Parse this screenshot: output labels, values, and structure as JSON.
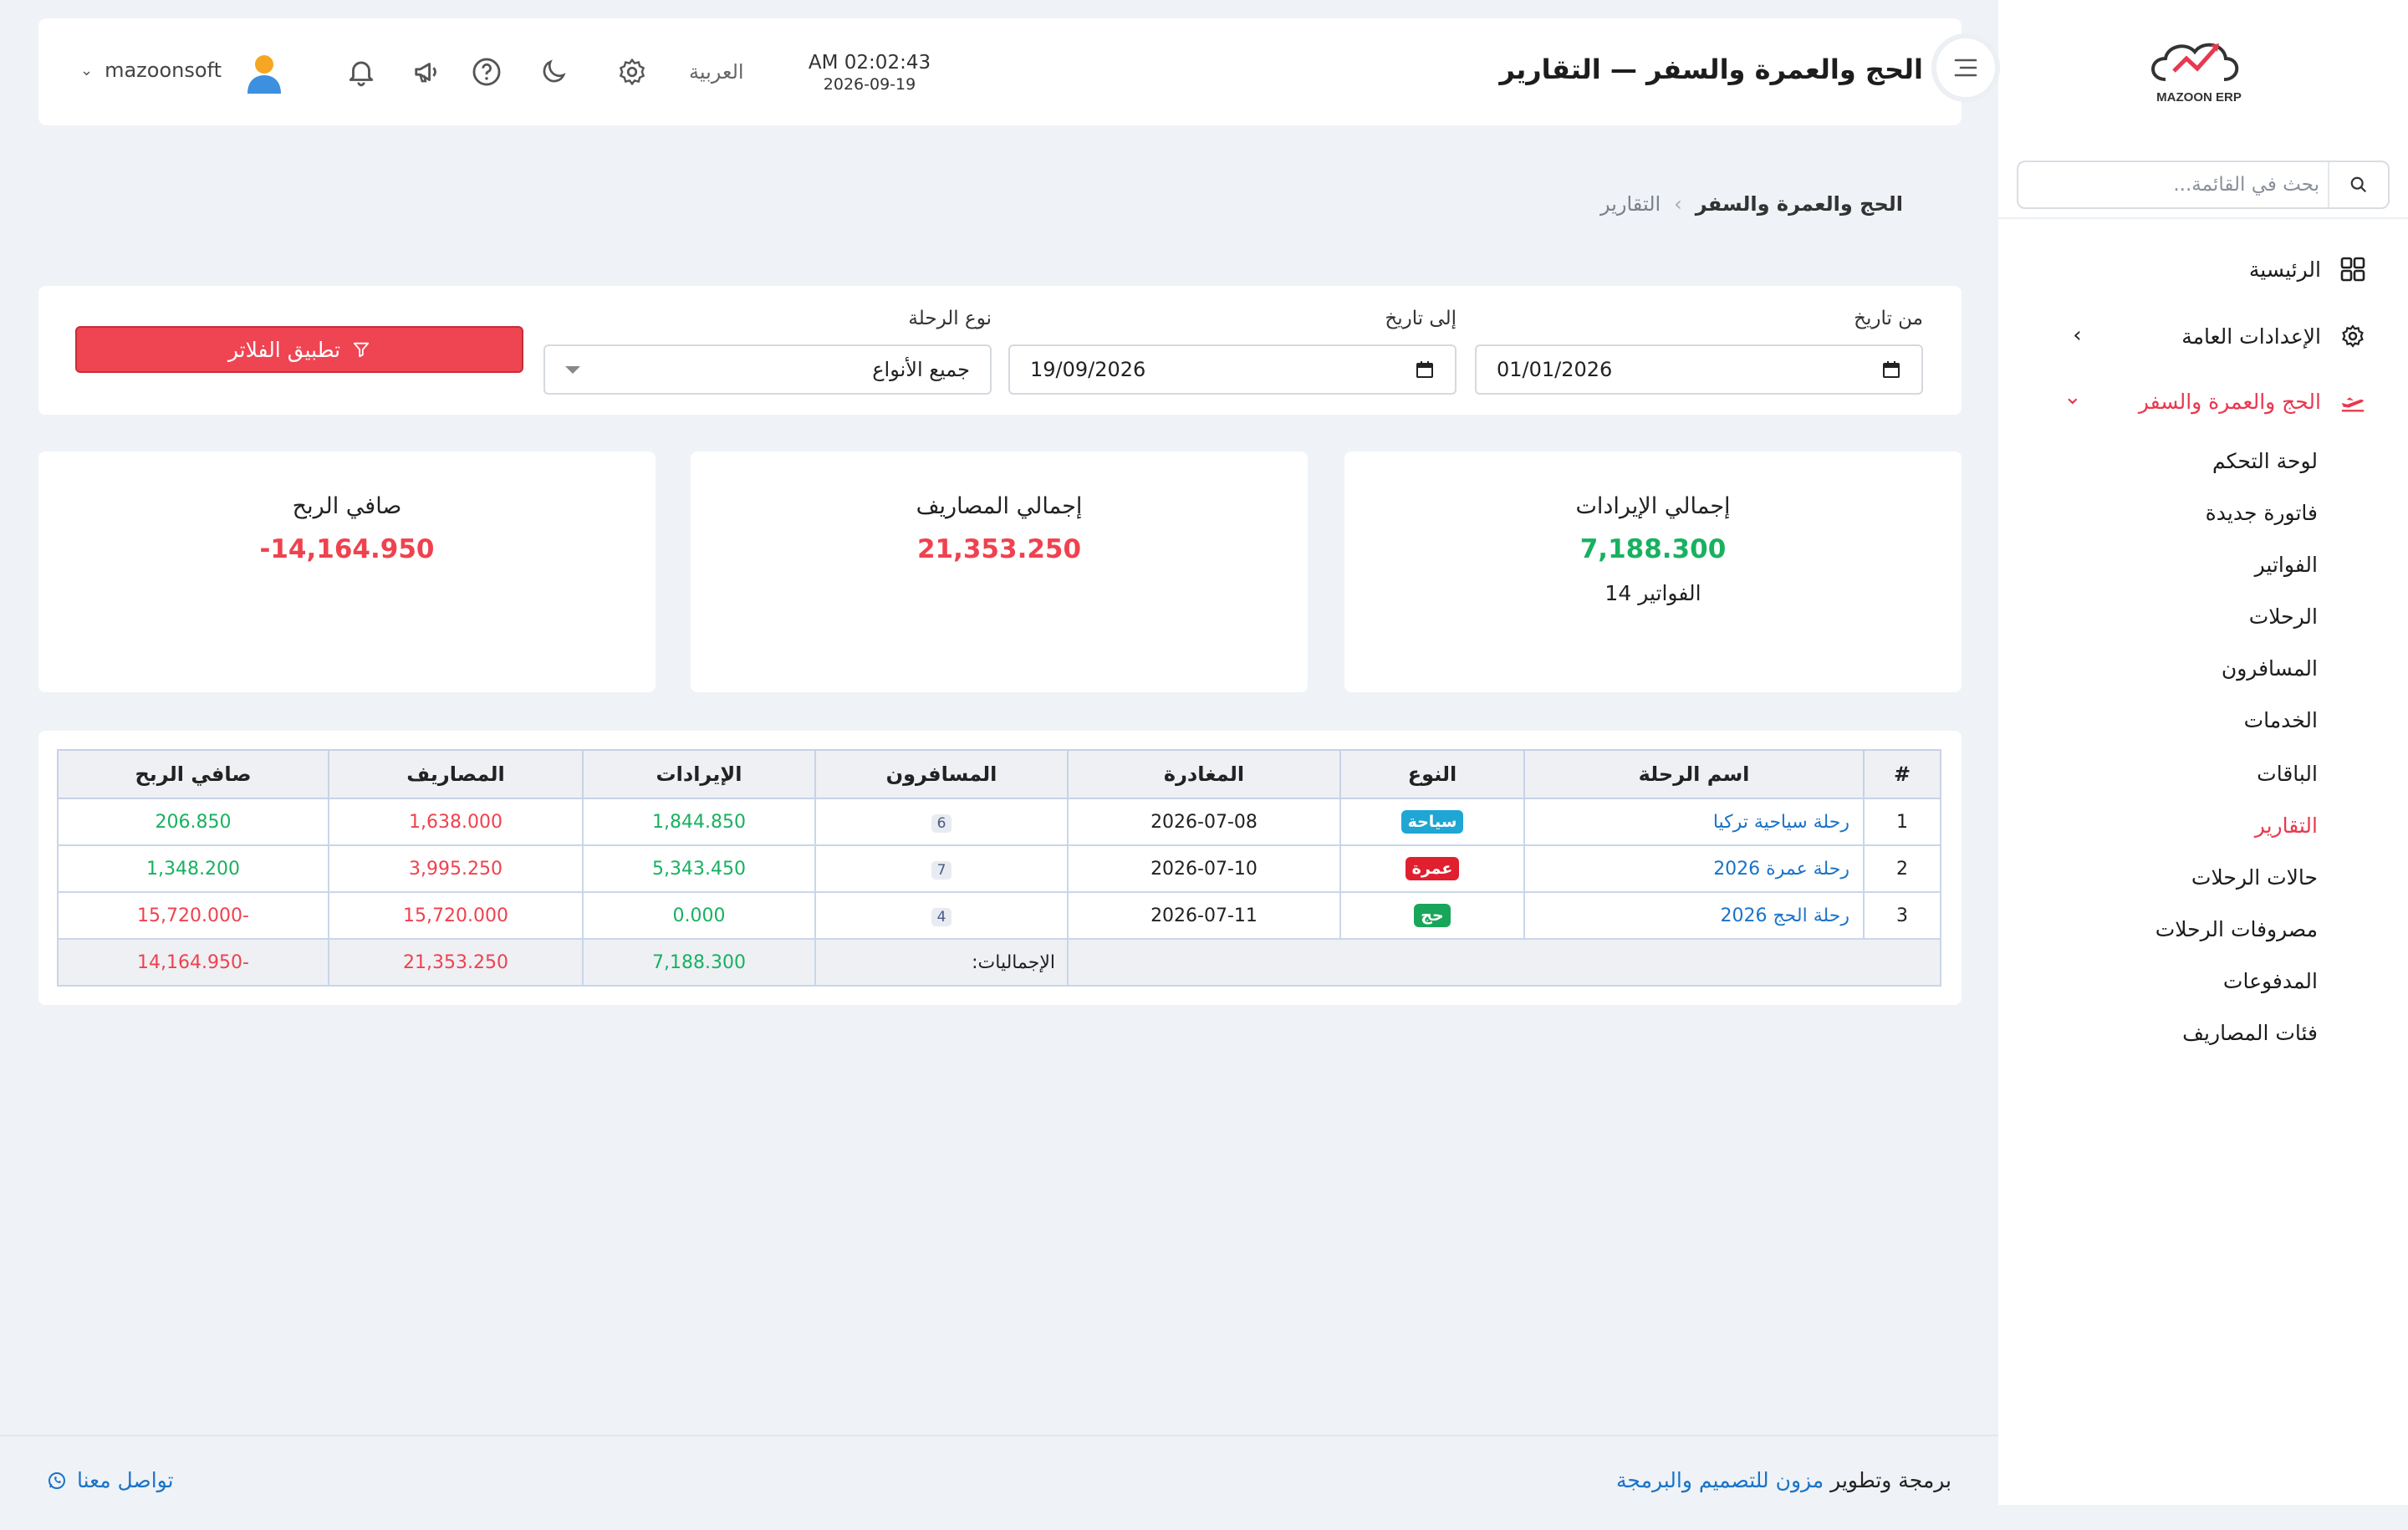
{
  "sidebar": {
    "logo_text": "MAZOON ERP",
    "search_placeholder": "بحث في القائمة...",
    "menu": [
      {
        "label": "الرئيسية"
      },
      {
        "label": "الإعدادات العامة"
      },
      {
        "label": "الحج والعمرة والسفر"
      }
    ],
    "submenu": [
      "لوحة التحكم",
      "فاتورة جديدة",
      "الفواتير",
      "الرحلات",
      "المسافرون",
      "الخدمات",
      "الباقات",
      "التقارير",
      "حالات الرحلات",
      "مصروفات الرحلات",
      "المدفوعات",
      "فئات المصاريف"
    ]
  },
  "header": {
    "title": "الحج والعمرة والسفر — التقارير",
    "time": "AM 02:02:43",
    "date": "2026-09-19",
    "language": "العربية",
    "username": "mazoonsoft"
  },
  "breadcrumb": {
    "parent": "الحج والعمرة والسفر",
    "current": "التقارير"
  },
  "filters": {
    "from_label": "من تاريخ",
    "from_value": "01/01/2026",
    "to_label": "إلى تاريخ",
    "to_value": "19/09/2026",
    "type_label": "نوع الرحلة",
    "type_value": "جميع الأنواع",
    "apply_label": "تطبيق الفلاتر"
  },
  "stats": {
    "revenue": {
      "label": "إجمالي الإيرادات",
      "value": "7,188.300",
      "sub": "14 الفواتير"
    },
    "expenses": {
      "label": "إجمالي المصاريف",
      "value": "21,353.250"
    },
    "profit": {
      "label": "صافي الربح",
      "value": "-14,164.950"
    }
  },
  "table": {
    "headers": [
      "#",
      "اسم الرحلة",
      "النوع",
      "المغادرة",
      "المسافرون",
      "الإيرادات",
      "المصاريف",
      "صافي الربح"
    ],
    "rows": [
      {
        "n": "1",
        "name": "رحلة سياحية تركيا",
        "type": "سياحة",
        "type_color": "#1fa6d4",
        "date": "2026-07-08",
        "pax": "6",
        "revenue": "1,844.850",
        "expenses": "1,638.000",
        "profit": "206.850",
        "profit_color": "#18b160"
      },
      {
        "n": "2",
        "name": "رحلة عمرة 2026",
        "type": "عمرة",
        "type_color": "#e0202f",
        "date": "2026-07-10",
        "pax": "7",
        "revenue": "5,343.450",
        "expenses": "3,995.250",
        "profit": "1,348.200",
        "profit_color": "#18b160"
      },
      {
        "n": "3",
        "name": "رحلة الحج 2026",
        "type": "حج",
        "type_color": "#1aa65a",
        "date": "2026-07-11",
        "pax": "4",
        "revenue": "0.000",
        "expenses": "15,720.000",
        "profit": "-15,720.000",
        "profit_color": "#f0414e"
      }
    ],
    "totals": {
      "label": "الإجماليات:",
      "revenue": "7,188.300",
      "expenses": "21,353.250",
      "profit": "-14,164.950"
    }
  },
  "footer": {
    "prefix": "برمجة وتطوير",
    "company": "مزون للتصميم والبرمجة",
    "contact": "تواصل معنا"
  },
  "colors": {
    "accent": "#e8384f",
    "positive": "#18b160",
    "negative": "#f0414e",
    "link": "#1a73c8"
  }
}
